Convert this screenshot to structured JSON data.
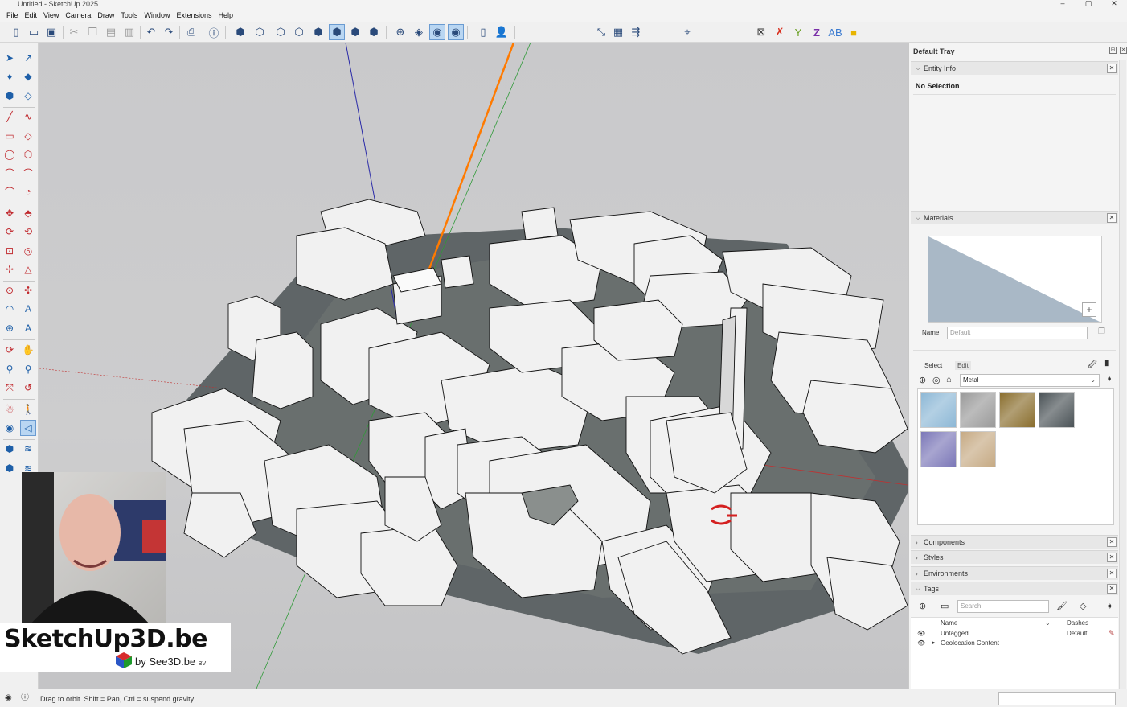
{
  "window": {
    "title": "Untitled - SketchUp 2025",
    "controls": [
      "–",
      "▢",
      "✕"
    ]
  },
  "menu": [
    "File",
    "Edit",
    "View",
    "Camera",
    "Draw",
    "Tools",
    "Window",
    "Extensions",
    "Help"
  ],
  "tray": {
    "title": "Default Tray",
    "entity_info": {
      "header": "Entity Info",
      "selection": "No Selection"
    },
    "materials": {
      "header": "Materials",
      "name_label": "Name",
      "name_placeholder": "Default",
      "tab_select": "Select",
      "tab_edit": "Edit",
      "library": "Metal",
      "swatch_colors": [
        "#8db8d6",
        "#9a9a9a",
        "#8a6e2e",
        "#4b5357",
        "#7c78b8",
        "#c6aa84"
      ]
    },
    "collapsed_panels": [
      "Components",
      "Styles",
      "Environments"
    ],
    "tags": {
      "header": "Tags",
      "search_placeholder": "Search",
      "col_name": "Name",
      "col_dashes": "Dashes",
      "rows": [
        {
          "name": "Untagged",
          "dashes": "Default"
        },
        {
          "name": "Geolocation Content",
          "dashes": ""
        }
      ]
    }
  },
  "status": {
    "message": "Drag to orbit. Shift = Pan, Ctrl = suspend gravity."
  },
  "brand": {
    "title": "SketchUp3D.be",
    "subtitle": "by See3D.be",
    "suffix": "BV"
  }
}
